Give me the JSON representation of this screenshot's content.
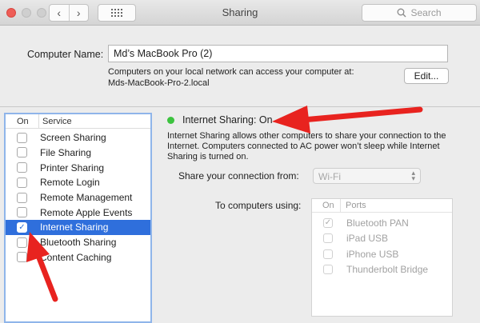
{
  "window": {
    "title": "Sharing",
    "search_placeholder": "Search"
  },
  "computer_name": {
    "label": "Computer Name:",
    "value": "Md’s MacBook Pro (2)",
    "desc_line1": "Computers on your local network can access your computer at:",
    "desc_line2": "Mds-MacBook-Pro-2.local",
    "edit_label": "Edit..."
  },
  "services": {
    "col_on": "On",
    "col_service": "Service",
    "items": [
      {
        "label": "Screen Sharing",
        "checked": false
      },
      {
        "label": "File Sharing",
        "checked": false
      },
      {
        "label": "Printer Sharing",
        "checked": false
      },
      {
        "label": "Remote Login",
        "checked": false
      },
      {
        "label": "Remote Management",
        "checked": false
      },
      {
        "label": "Remote Apple Events",
        "checked": false
      },
      {
        "label": "Internet Sharing",
        "checked": true,
        "selected": true
      },
      {
        "label": "Bluetooth Sharing",
        "checked": false
      },
      {
        "label": "Content Caching",
        "checked": false
      }
    ]
  },
  "detail": {
    "status": "Internet Sharing: On",
    "status_color": "#3cc33f",
    "description": "Internet Sharing allows other computers to share your connection to the Internet. Computers connected to AC power won’t sleep while Internet Sharing is turned on.",
    "share_from_label": "Share your connection from:",
    "share_from_value": "Wi-Fi",
    "to_computers_label": "To computers using:",
    "ports_col_on": "On",
    "ports_col_ports": "Ports",
    "ports": [
      {
        "label": "Bluetooth PAN",
        "checked": true
      },
      {
        "label": "iPad USB",
        "checked": false
      },
      {
        "label": "iPhone USB",
        "checked": false
      },
      {
        "label": "Thunderbolt Bridge",
        "checked": false
      }
    ]
  },
  "colors": {
    "accent": "#2f6fdc",
    "annotation": "#e8231f"
  }
}
